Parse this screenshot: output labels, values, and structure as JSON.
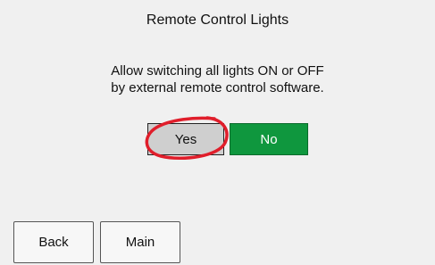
{
  "dialog": {
    "title": "Remote Control Lights",
    "message_line1": "Allow switching all lights ON or OFF",
    "message_line2": "by external remote control software."
  },
  "buttons": {
    "yes_label": "Yes",
    "no_label": "No"
  },
  "nav": {
    "back_label": "Back",
    "main_label": "Main"
  },
  "colors": {
    "background": "#f0f0f0",
    "no_button": "#0f973e",
    "yes_button": "#cfcfcf",
    "highlight_circle": "#e01e2b"
  }
}
